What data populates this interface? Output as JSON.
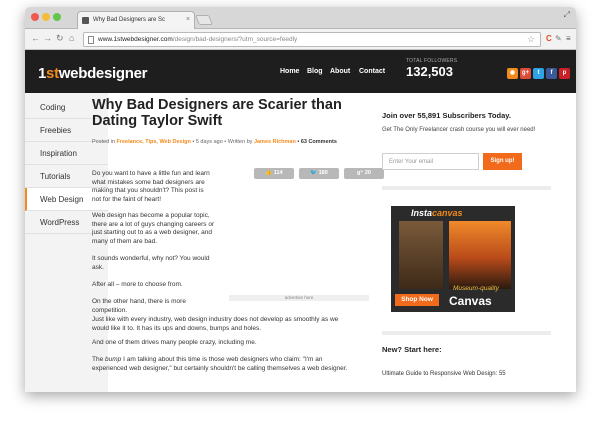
{
  "browser": {
    "tab_title": "Why Bad Designers are Sc",
    "url_host": "www.1stwebdesigner.com",
    "url_path": "/design/bad-designers/?utm_source=feedly"
  },
  "site": {
    "logo_prefix": "1",
    "logo_accent": "st",
    "logo_rest": "webdesigner",
    "nav": [
      "Home",
      "Blog",
      "About",
      "Contact"
    ],
    "followers_label": "TOTAL FOLLOWERS",
    "followers_count": "132,503"
  },
  "sidebar": {
    "items": [
      {
        "label": "Coding"
      },
      {
        "label": "Freebies"
      },
      {
        "label": "Inspiration"
      },
      {
        "label": "Tutorials"
      },
      {
        "label": "Web Design"
      },
      {
        "label": "WordPress"
      }
    ],
    "active": "Web Design"
  },
  "article": {
    "title_line1": "Why Bad Designers are Scarier than",
    "title_line2": "Dating Taylor Swift",
    "meta_posted": "Posted in",
    "meta_categories": "Freelance, Tips, Web Design",
    "meta_ago": "• 5 days ago • Written by",
    "meta_author": "James Richman",
    "meta_comments": "• 63 Comments",
    "share_like": "114",
    "share_tweet": "180",
    "share_gplus": "20",
    "ad_label": "advertise here",
    "p1": [
      "Do you want to have a little fun and learn",
      "what mistakes some bad designers are",
      "making that you shouldn't? This post is",
      "not for the faint of heart!"
    ],
    "p2": [
      "Web design has become a popular topic,",
      "there are a lot of guys changing careers or",
      "just starting out to as a web designer, and",
      "many of them are bad."
    ],
    "p3": [
      "It sounds wonderful, why not? You would",
      "ask."
    ],
    "p4": "After all – more to choose from.",
    "p5": [
      "On the other hand, there is more",
      "competition."
    ],
    "p6": [
      "Just like with every industry, web design industry does not develop as smoothly as we",
      "would like it to. It has its ups and downs, bumps and holes."
    ],
    "p7": "And one of them drives many people crazy, including me.",
    "p8_pre": "The",
    "p8_em": "bump",
    "p8_post": "I am talking about this time is those web designers who claim: \"I'm an",
    "p8_line2": "experienced web designer,\" but certainly shouldn't be calling themselves a web designer."
  },
  "right": {
    "join_title": "Join over 55,891 Subscribers Today.",
    "join_sub": "Get The Only Freelancer crash course you will ever need!",
    "email_placeholder": "Enter Your email",
    "signup": "Sign up!",
    "ad_brand_1": "Insta",
    "ad_brand_2": "canvas",
    "ad_shop": "Shop Now",
    "ad_museum": "Museum-quality",
    "ad_canvas": "Canvas",
    "new_start": "New? Start here:",
    "guide": "Ultimate Guide to Responsive Web Design: 55"
  },
  "colors": {
    "accent": "#f28b1b",
    "header_bg": "#1e1e1e",
    "signup": "#f26a1b"
  }
}
